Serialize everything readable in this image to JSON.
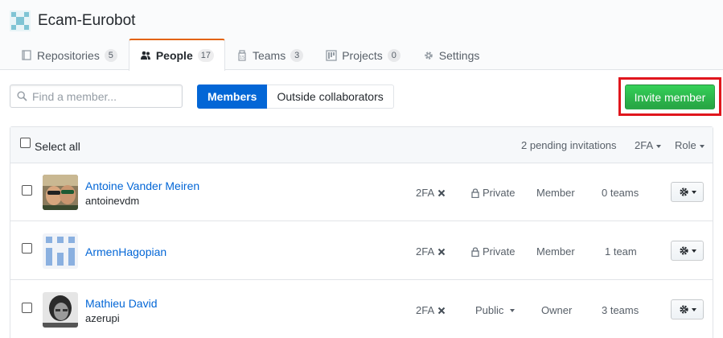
{
  "org": {
    "name": "Ecam-Eurobot"
  },
  "tabs": [
    {
      "label": "Repositories",
      "count": "5",
      "icon": "repo-icon"
    },
    {
      "label": "People",
      "count": "17",
      "icon": "people-icon"
    },
    {
      "label": "Teams",
      "count": "3",
      "icon": "jersey-icon"
    },
    {
      "label": "Projects",
      "count": "0",
      "icon": "project-icon"
    },
    {
      "label": "Settings",
      "icon": "gear-icon"
    }
  ],
  "toolbar": {
    "search_placeholder": "Find a member...",
    "members_label": "Members",
    "outside_label": "Outside collaborators",
    "invite_label": "Invite member"
  },
  "table": {
    "select_all": "Select all",
    "pending": "2 pending invitations",
    "twofa_filter": "2FA",
    "role_filter": "Role"
  },
  "members": [
    {
      "name": "Antoine Vander Meiren",
      "login": "antoinevdm",
      "twofa": "2FA",
      "visibility": "Private",
      "role": "Member",
      "teams": "0 teams"
    },
    {
      "name": "ArmenHagopian",
      "login": "",
      "twofa": "2FA",
      "visibility": "Private",
      "role": "Member",
      "teams": "1 team"
    },
    {
      "name": "Mathieu David",
      "login": "azerupi",
      "twofa": "2FA",
      "visibility": "Public",
      "role": "Owner",
      "teams": "3 teams"
    }
  ],
  "colors": {
    "accent": "#0366d6",
    "invite_green": "#28a745",
    "highlight_red": "#e0161d",
    "tab_orange": "#e36209"
  }
}
